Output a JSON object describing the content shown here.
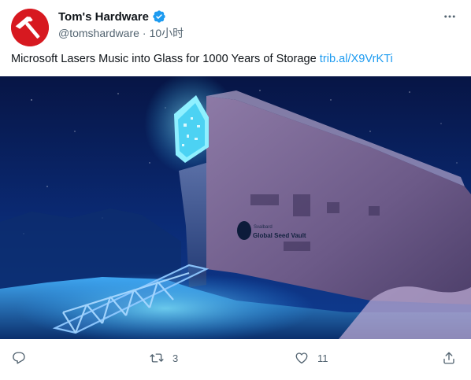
{
  "author": {
    "display_name": "Tom's Hardware",
    "handle": "@tomshardware",
    "separator": "·",
    "time": "10小时",
    "verified": true
  },
  "tweet": {
    "text": "Microsoft Lasers Music into Glass for 1000 Years of Storage",
    "link": "trib.al/X9VrKTi"
  },
  "media": {
    "sign_small": "Svalbard",
    "sign_text": "Global Seed Vault"
  },
  "actions": {
    "reply_count": "",
    "retweet_count": "3",
    "like_count": "11"
  },
  "icons": {
    "avatar": "hammer-logo",
    "verified": "verified-badge-icon",
    "more": "more-icon",
    "reply": "reply-icon",
    "retweet": "retweet-icon",
    "like": "heart-icon",
    "share": "share-icon"
  },
  "colors": {
    "brand_red": "#d71920",
    "link_blue": "#1d9bf0",
    "verified_blue": "#1d9bf0",
    "muted": "#536471",
    "text": "#0f1419"
  }
}
